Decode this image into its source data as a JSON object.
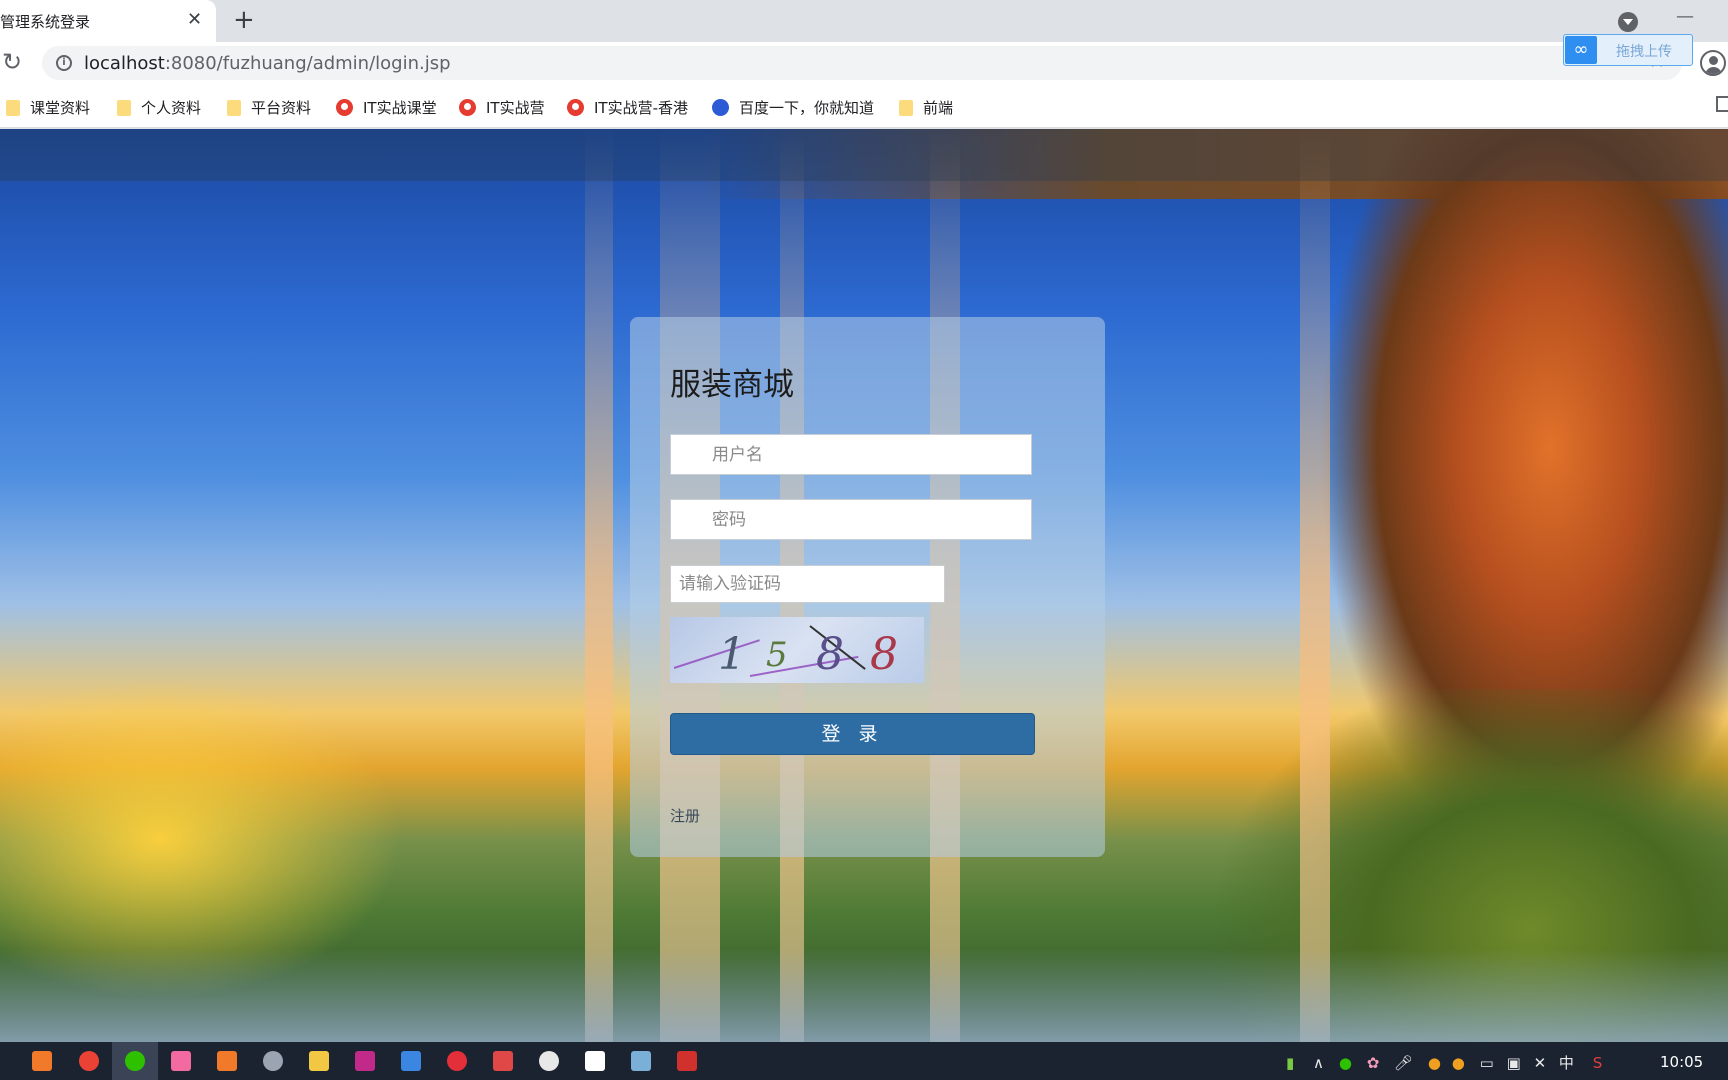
{
  "browser": {
    "tab_title": "管理系统登录",
    "tab_close": "✕",
    "new_tab": "+",
    "url_host": "localhost",
    "url_rest": ":8080/fuzhuang/admin/login.jsp",
    "upload_label": "拖拽上传"
  },
  "bookmarks": [
    {
      "label": "课堂资料",
      "icon": "folder-icon"
    },
    {
      "label": "个人资料",
      "icon": "folder-icon"
    },
    {
      "label": "平台资料",
      "icon": "folder-icon"
    },
    {
      "label": "IT实战课堂",
      "icon": "red-site-icon"
    },
    {
      "label": "IT实战营",
      "icon": "red-site-icon"
    },
    {
      "label": "IT实战营-香港",
      "icon": "red-site-icon"
    },
    {
      "label": "百度一下，你就知道",
      "icon": "baidu-paw-icon"
    },
    {
      "label": "前端",
      "icon": "folder-icon"
    }
  ],
  "login": {
    "title": "服装商城",
    "username_placeholder": "用户名",
    "password_placeholder": "密码",
    "captcha_placeholder": "请输入验证码",
    "captcha_digits": [
      "1",
      "5",
      "8",
      "8"
    ],
    "login_button": "登 录",
    "register_link": "注册"
  },
  "taskbar": {
    "clock": "10:05",
    "ime": "中"
  },
  "colors": {
    "login_button": "#2e6da4",
    "taskbar": "#1c2330"
  }
}
